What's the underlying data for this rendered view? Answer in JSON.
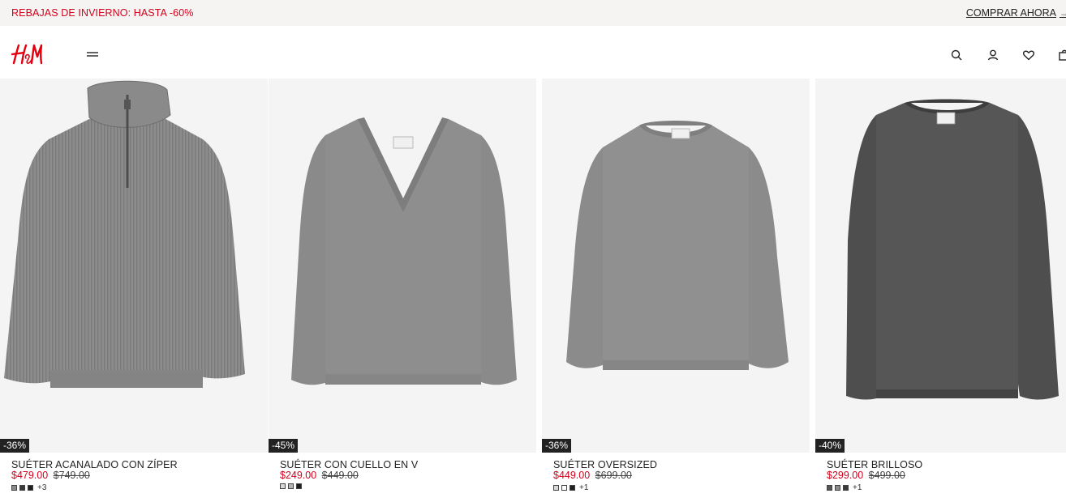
{
  "promo": {
    "text": "REBAJAS DE INVIERNO: HASTA -60%",
    "cta": "COMPRAR AHORA",
    "text_color": "#d6001c"
  },
  "header": {
    "logo_text": "H&M",
    "logo_color": "#e50010",
    "icons": [
      "menu-icon",
      "search-icon",
      "account-icon",
      "heart-icon",
      "bag-icon"
    ]
  },
  "products": [
    {
      "badge": "-36%",
      "name": "SUÉTER ACANALADO CON ZÍPER",
      "price": "$479.00",
      "old_price": "$749.00",
      "swatches": [
        "#8a8a8a",
        "#3a3a3a",
        "#1f1f1f"
      ],
      "more": "+3"
    },
    {
      "badge": "-45%",
      "name": "SUÉTER CON CUELLO EN V",
      "price": "$249.00",
      "old_price": "$449.00",
      "swatches": [
        "#d8d8d8",
        "#b5b5b5",
        "#1f1f1f"
      ],
      "more": ""
    },
    {
      "badge": "-36%",
      "name": "SUÉTER OVERSIZED",
      "price": "$449.00",
      "old_price": "$699.00",
      "swatches": [
        "#d8d8d8",
        "#ffffff",
        "#1f1f1f"
      ],
      "more": "+1"
    },
    {
      "badge": "-40%",
      "name": "SUÉTER BRILLOSO",
      "price": "$299.00",
      "old_price": "$499.00",
      "swatches": [
        "#555555",
        "#8a8a8a",
        "#3a3a3a"
      ],
      "more": "+1"
    }
  ]
}
